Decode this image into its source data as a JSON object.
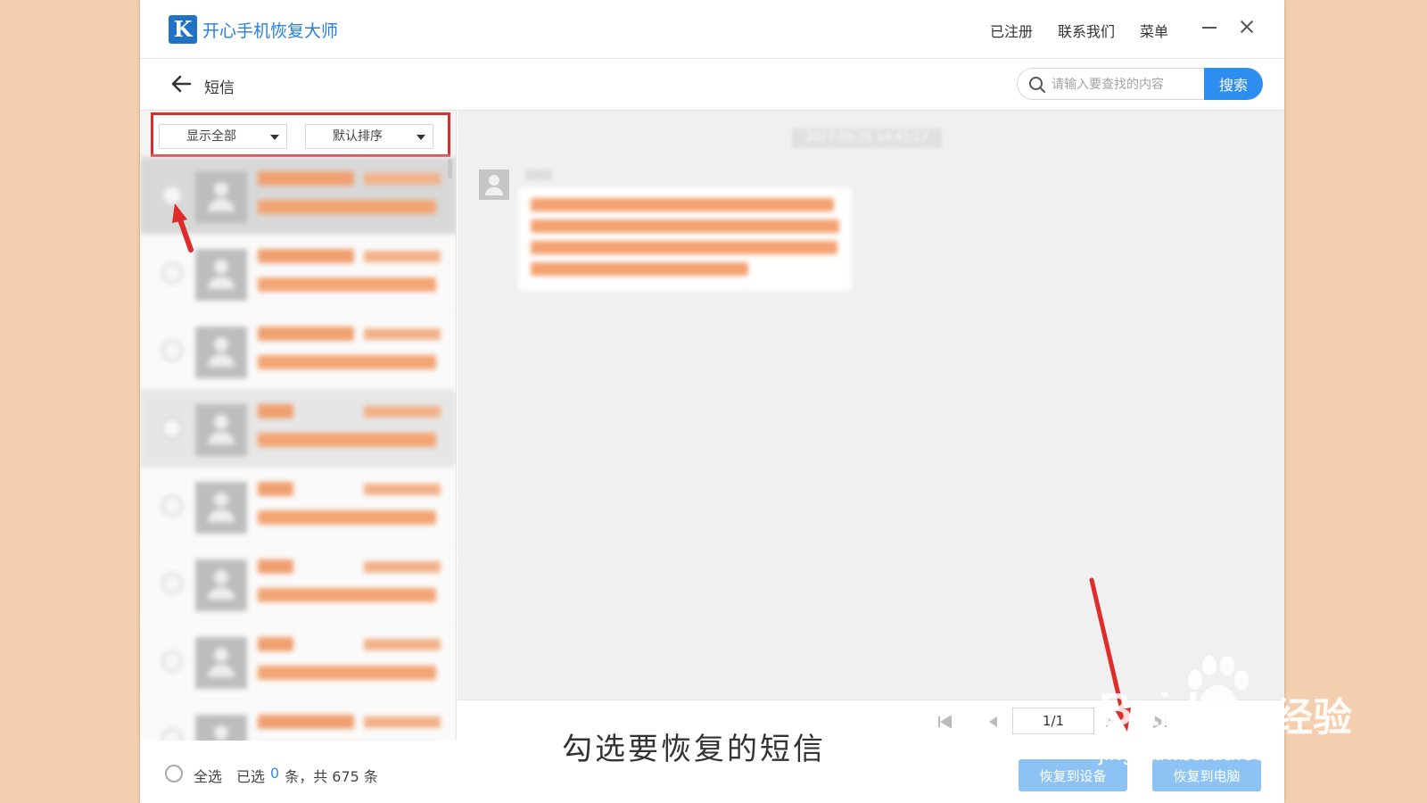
{
  "app": {
    "title": "开心手机恢复大师",
    "logo_letter": "K"
  },
  "top_nav": {
    "registered": "已注册",
    "contact": "联系我们",
    "menu": "菜单"
  },
  "header": {
    "page_title": "短信"
  },
  "search": {
    "placeholder": "请输入要查找的内容",
    "button": "搜索"
  },
  "filters": {
    "show": "显示全部",
    "sort": "默认排序"
  },
  "conversation": {
    "date": "2017-09-25 14:41:17"
  },
  "pager": {
    "page": "1/1"
  },
  "footer": {
    "select_all": "全选",
    "selected_prefix": "已选",
    "selected_count": "0",
    "total_text": "条，共 675 条",
    "restore_device": "恢复到设备",
    "restore_pc": "恢复到电脑"
  },
  "caption": "勾选要恢复的短信",
  "watermark": {
    "brand": "Bai",
    "brand_du": "du",
    "text": "经验",
    "url": "jingyan.baidu.com"
  },
  "colors": {
    "accent": "#2d8ef0",
    "highlight": "#e02b2b",
    "background": "#f3cfb0"
  }
}
